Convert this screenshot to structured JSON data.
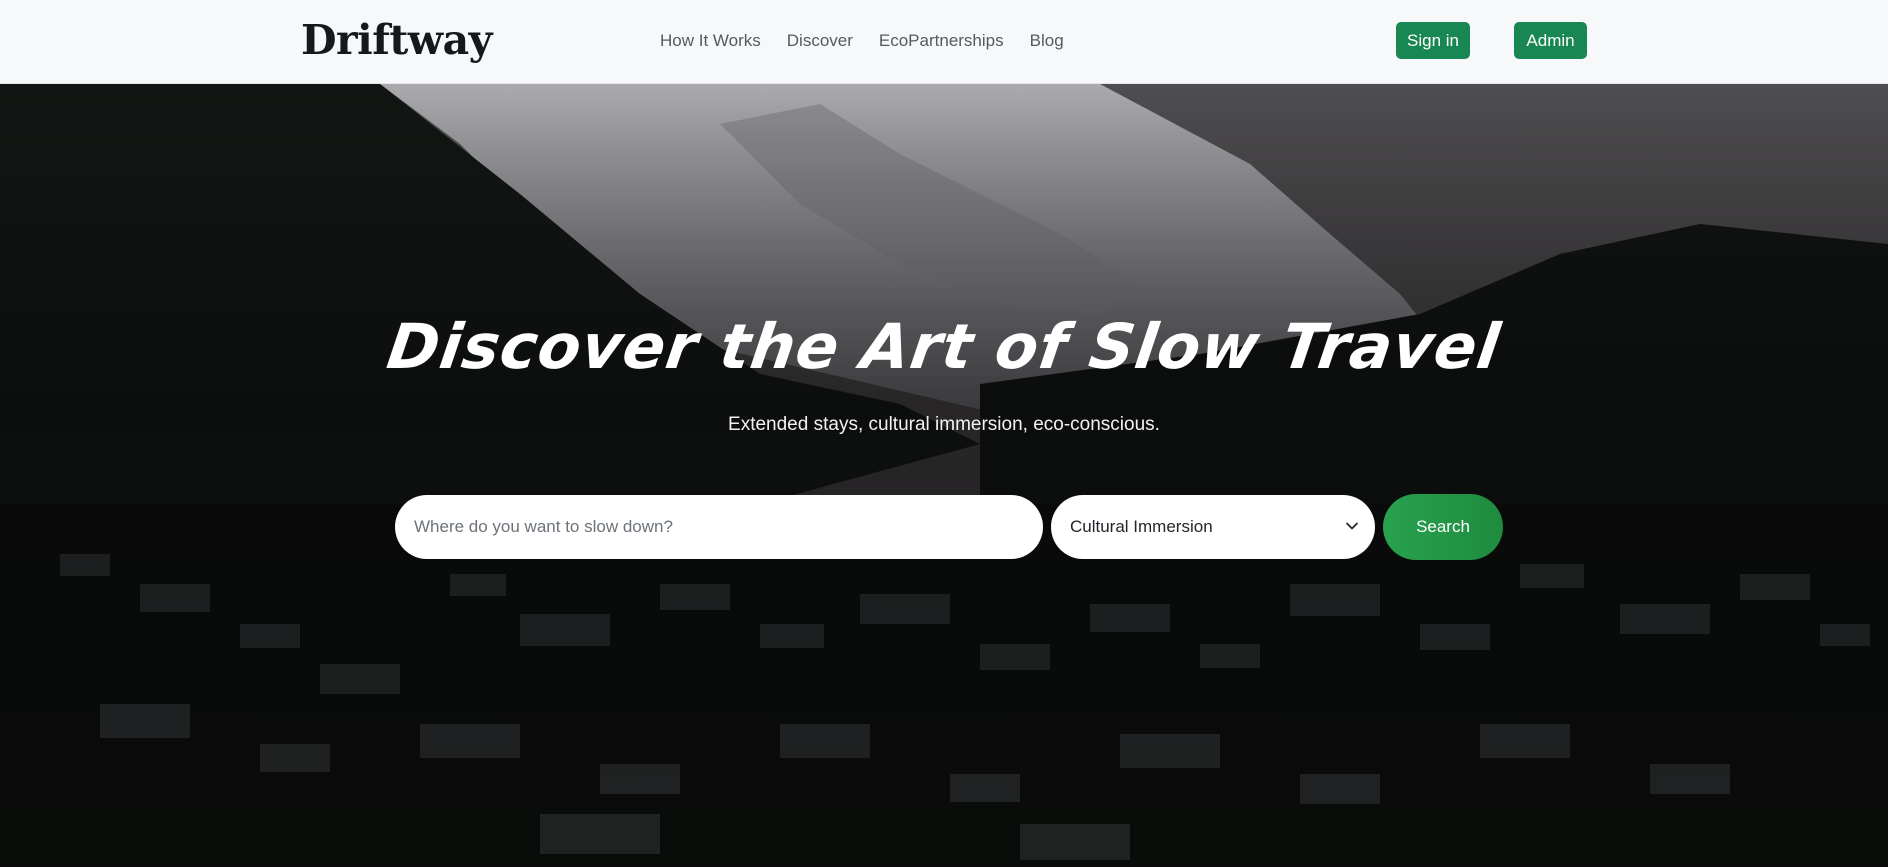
{
  "header": {
    "brand": "Driftway",
    "nav": [
      "How It Works",
      "Discover",
      "EcoPartnerships",
      "Blog"
    ],
    "signin_label": "Sign in",
    "admin_label": "Admin"
  },
  "hero": {
    "title": "Discover the Art of Slow Travel",
    "subtitle": "Extended stays, cultural immersion, eco-conscious.",
    "search_placeholder": "Where do you want to slow down?",
    "select_value": "Cultural Immersion",
    "search_label": "Search"
  },
  "colors": {
    "accent": "#198754",
    "search_button": "#28a24e",
    "nav_background": "#f7f8fa"
  },
  "icons": {
    "select_caret": "chevron-down-icon"
  }
}
